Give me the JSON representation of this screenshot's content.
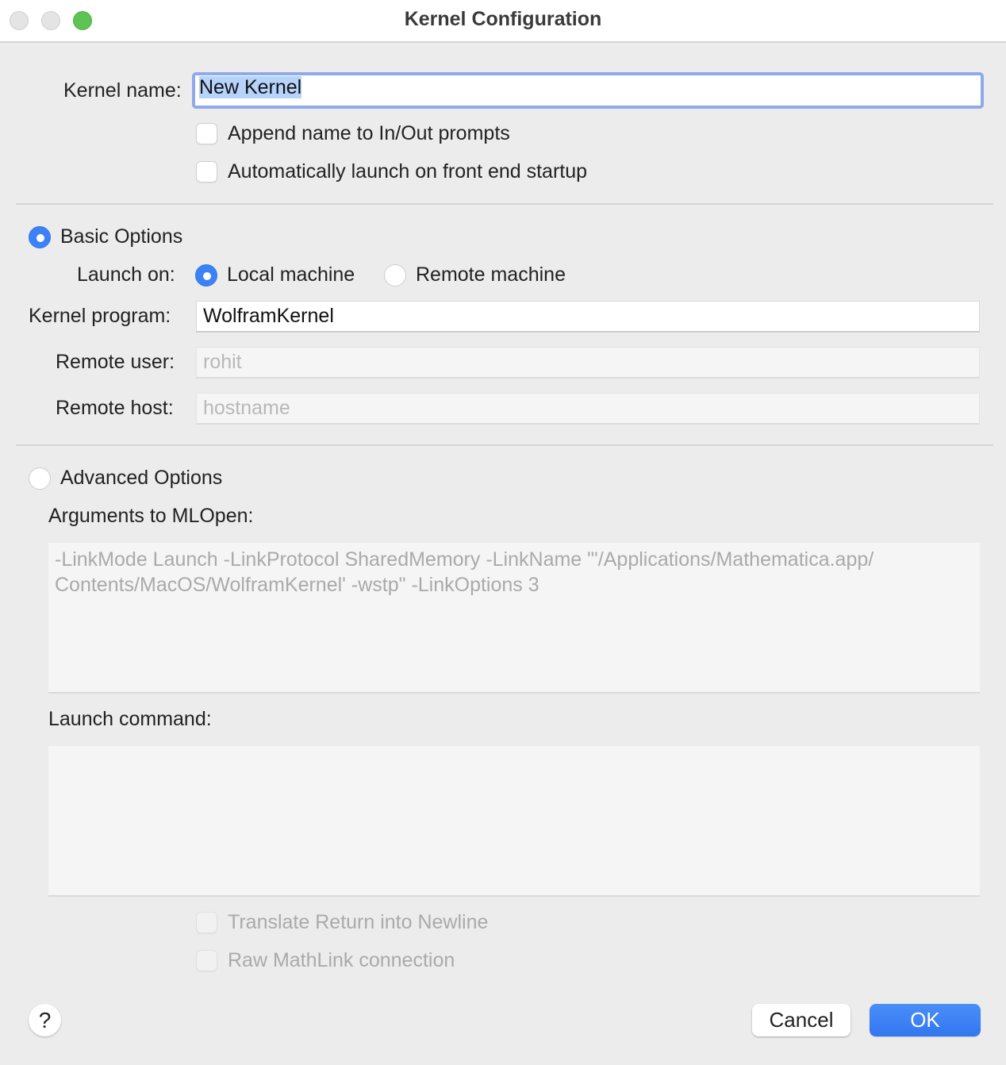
{
  "window": {
    "title": "Kernel Configuration",
    "controls": [
      "close",
      "minimize",
      "zoom"
    ]
  },
  "kernel_name": {
    "label": "Kernel name:",
    "value": "New Kernel",
    "focused": true,
    "text_selected": true
  },
  "general_options": [
    {
      "label": "Append name to In/Out prompts",
      "checked": false,
      "enabled": true
    },
    {
      "label": "Automatically launch on front end startup",
      "checked": false,
      "enabled": true
    }
  ],
  "basic_options": {
    "label": "Basic Options",
    "selected": true,
    "launch_on": {
      "label": "Launch on:",
      "options": [
        {
          "label": "Local machine",
          "selected": true
        },
        {
          "label": "Remote machine",
          "selected": false
        }
      ]
    },
    "kernel_program": {
      "label": "Kernel program:",
      "value": "WolframKernel"
    },
    "remote_user": {
      "label": "Remote user:",
      "placeholder": "rohit",
      "enabled": false
    },
    "remote_host": {
      "label": "Remote host:",
      "placeholder": "hostname",
      "enabled": false
    }
  },
  "advanced_options": {
    "label": "Advanced Options",
    "selected": false,
    "arguments": {
      "label": "Arguments to MLOpen:",
      "value": "-LinkMode Launch -LinkProtocol SharedMemory -LinkName \"'/Applications/Mathematica.app/\nContents/MacOS/WolframKernel' -wstp\" -LinkOptions 3",
      "enabled": false
    },
    "launch_command": {
      "label": "Launch command:",
      "value": "",
      "enabled": false
    },
    "checkboxes": [
      {
        "label": "Translate Return into Newline",
        "checked": false,
        "enabled": false
      },
      {
        "label": "Raw MathLink connection",
        "checked": false,
        "enabled": false
      }
    ]
  },
  "footer": {
    "help_label": "?",
    "cancel_label": "Cancel",
    "ok_label": "OK"
  },
  "colors": {
    "accent": "#3c82f6",
    "focus_ring": "#8faaea",
    "selection": "#b5d3fb",
    "zoom_button": "#5ec354",
    "background": "#ececec"
  }
}
